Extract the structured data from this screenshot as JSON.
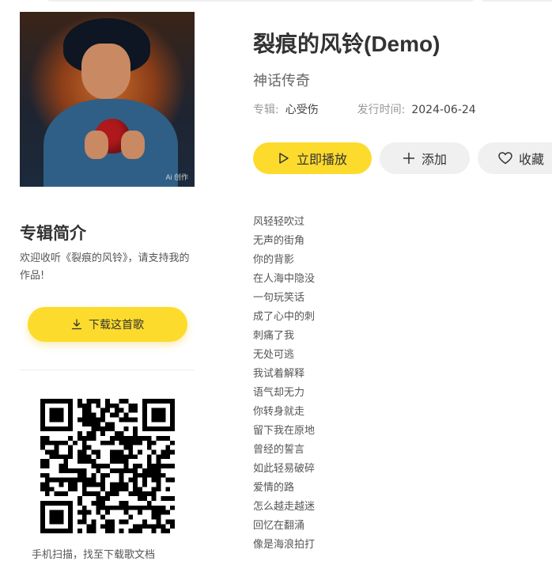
{
  "song": {
    "title": "裂痕的风铃(Demo)",
    "artist": "神话传奇",
    "album_label": "专辑:",
    "album": "心受伤",
    "release_label": "发行时间:",
    "release_date": "2024-06-24"
  },
  "cover": {
    "watermark": "Ai 创作"
  },
  "actions": {
    "play_label": "立即播放",
    "add_label": "添加",
    "favorite_label": "收藏"
  },
  "intro": {
    "heading": "专辑简介",
    "text": "欢迎收听《裂痕的风铃》，请支持我的作品!"
  },
  "download": {
    "label": "下载这首歌"
  },
  "qr": {
    "caption": "手机扫描，找至下载歌文档"
  },
  "lyrics": [
    "风轻轻吹过",
    "无声的街角",
    "你的背影",
    "在人海中隐没",
    "一句玩笑话",
    "成了心中的刺",
    "刺痛了我",
    "无处可逃",
    "我试着解释",
    "语气却无力",
    "你转身就走",
    "留下我在原地",
    "曾经的誓言",
    "如此轻易破碎",
    "爱情的路",
    "怎么越走越迷",
    "回忆在翻涌",
    "像是海浪拍打"
  ],
  "colors": {
    "accent": "#fddb2c",
    "secondary_button": "#f0f0f0"
  },
  "icons": {
    "play": "play-icon",
    "add": "plus-icon",
    "favorite": "heart-icon",
    "download": "download-icon"
  }
}
